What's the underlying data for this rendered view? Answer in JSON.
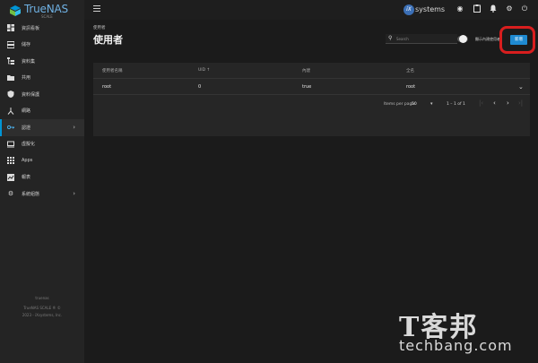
{
  "app": {
    "logo_text": "TrueNAS",
    "logo_sub": "SCALE"
  },
  "sidebar": {
    "items": [
      {
        "label": "資訊看板",
        "icon": "dashboard-icon"
      },
      {
        "label": "儲存",
        "icon": "storage-icon"
      },
      {
        "label": "資料集",
        "icon": "datasets-icon"
      },
      {
        "label": "共用",
        "icon": "shares-icon"
      },
      {
        "label": "資料保護",
        "icon": "shield-icon"
      },
      {
        "label": "網路",
        "icon": "network-icon"
      },
      {
        "label": "認證",
        "icon": "key-icon",
        "active": true,
        "expandable": true
      },
      {
        "label": "虛擬化",
        "icon": "monitor-icon"
      },
      {
        "label": "Apps",
        "icon": "apps-grid-icon"
      },
      {
        "label": "報表",
        "icon": "reports-icon"
      },
      {
        "label": "系統組態",
        "icon": "gear-icon",
        "expandable": true
      }
    ],
    "footer": {
      "hostname": "truenas",
      "version": "TrueNAS SCALE ® ©",
      "copyright": "2023 - iXsystems, Inc."
    }
  },
  "topbar": {
    "brand_text": "systems",
    "brand_mark": "iX",
    "icons": [
      "truecommand-icon",
      "clipboard-icon",
      "bell-icon",
      "settings-icon",
      "power-icon"
    ]
  },
  "page": {
    "breadcrumb": "使用者",
    "title": "使用者",
    "search_placeholder": "Search",
    "toggle_label": "顯示內建使用者",
    "add_button": "新增"
  },
  "table": {
    "columns": [
      "使用者名稱",
      "UID ↑",
      "內建",
      "全名"
    ],
    "rows": [
      {
        "username": "root",
        "uid": "0",
        "builtin": "true",
        "full_name": "root"
      }
    ]
  },
  "paginator": {
    "items_label": "Items per page:",
    "page_size": "50",
    "range": "1 – 1 of 1"
  },
  "watermark": {
    "mark": "T客邦",
    "text": "techbang.com"
  },
  "colors": {
    "accent": "#0095d5",
    "button": "#1f8ad1",
    "highlight": "#d81e1e"
  }
}
